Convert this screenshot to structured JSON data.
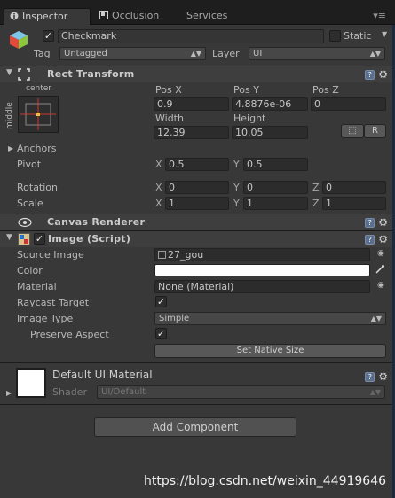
{
  "tabs": [
    {
      "label": "Inspector",
      "active": true
    },
    {
      "label": "Occlusion",
      "active": false
    },
    {
      "label": "Services",
      "active": false
    }
  ],
  "object": {
    "name": "Checkmark",
    "static_label": "Static",
    "tag_label": "Tag",
    "tag_value": "Untagged",
    "layer_label": "Layer",
    "layer_value": "UI"
  },
  "rect_transform": {
    "title": "Rect Transform",
    "anchor_h": "center",
    "anchor_v": "middle",
    "col_labels": [
      "Pos X",
      "Pos Y",
      "Pos Z"
    ],
    "pos_x": "0.9",
    "pos_y": "4.8876e-06",
    "pos_z": "0",
    "width_label": "Width",
    "height_label": "Height",
    "width": "12.39",
    "height": "10.05",
    "blueprint_btn": "⬚",
    "raw_btn": "R",
    "anchors_label": "Anchors",
    "pivot_label": "Pivot",
    "pivot_x": "0.5",
    "pivot_y": "0.5",
    "rotation_label": "Rotation",
    "rotation": {
      "x": "0",
      "y": "0",
      "z": "0"
    },
    "scale_label": "Scale",
    "scale": {
      "x": "1",
      "y": "1",
      "z": "1"
    },
    "axis": {
      "x": "X",
      "y": "Y",
      "z": "Z"
    }
  },
  "canvas_renderer": {
    "title": "Canvas Renderer"
  },
  "image": {
    "title": "Image (Script)",
    "source_image_label": "Source Image",
    "source_image_value": "27_gou",
    "color_label": "Color",
    "color_value": "#ffffff",
    "material_label": "Material",
    "material_value": "None (Material)",
    "raycast_label": "Raycast Target",
    "raycast_checked": true,
    "image_type_label": "Image Type",
    "image_type_value": "Simple",
    "preserve_label": "Preserve Aspect",
    "preserve_checked": true,
    "native_size_btn": "Set Native Size"
  },
  "material_preview": {
    "name": "Default UI Material",
    "shader_label": "Shader",
    "shader_value": "UI/Default"
  },
  "add_component": "Add Component",
  "watermark": "https://blog.csdn.net/weixin_44919646",
  "colors": {
    "background": "#383838",
    "header": "#3e3e3e",
    "field": "#2c2c2c",
    "accent_help": "#5a6f8e"
  }
}
